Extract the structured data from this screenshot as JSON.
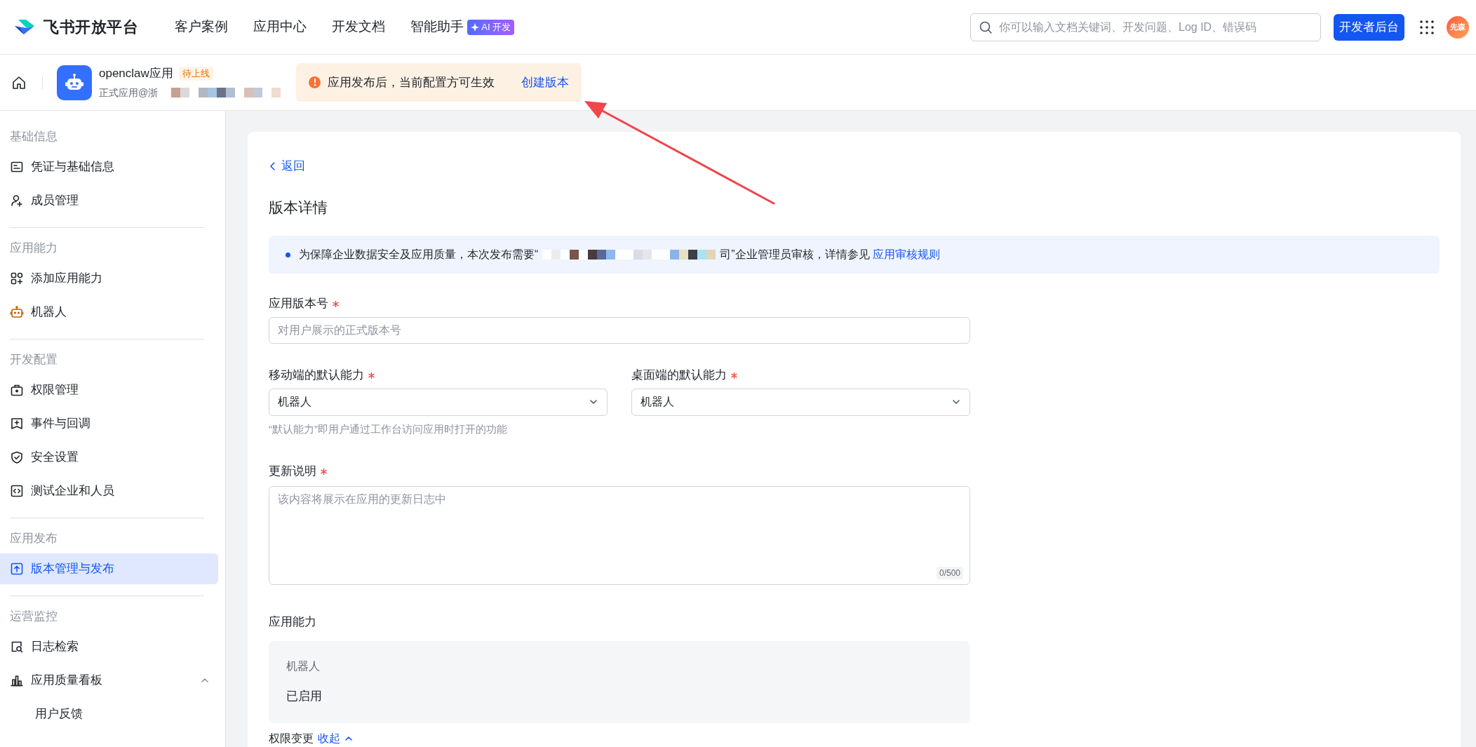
{
  "top_nav": {
    "logo_text": "飞书开放平台",
    "items": [
      {
        "label": "客户案例"
      },
      {
        "label": "应用中心"
      },
      {
        "label": "开发文档"
      },
      {
        "label": "智能助手",
        "badge": "AI 开发"
      }
    ],
    "search": {
      "placeholder": "你可以输入文档关键词、开发问题、Log ID、错误码"
    },
    "console_button": "开发者后台",
    "avatar_text": "先森"
  },
  "app_bar": {
    "name": "openclaw应用",
    "status_badge": "待上线",
    "subtitle": "正式应用@浙",
    "notice": {
      "text": "应用发布后，当前配置方可生效",
      "link": "创建版本"
    }
  },
  "sidebar": [
    {
      "heading": "基础信息",
      "items": [
        {
          "label": "凭证与基础信息",
          "selected": false
        },
        {
          "label": "成员管理",
          "selected": false
        }
      ]
    },
    {
      "heading": "应用能力",
      "items": [
        {
          "label": "添加应用能力",
          "selected": false
        },
        {
          "label": "机器人",
          "selected": false
        }
      ]
    },
    {
      "heading": "开发配置",
      "items": [
        {
          "label": "权限管理",
          "selected": false
        },
        {
          "label": "事件与回调",
          "selected": false
        },
        {
          "label": "安全设置",
          "selected": false
        },
        {
          "label": "测试企业和人员",
          "selected": false
        }
      ]
    },
    {
      "heading": "应用发布",
      "items": [
        {
          "label": "版本管理与发布",
          "selected": true
        }
      ]
    },
    {
      "heading": "运营监控",
      "items": [
        {
          "label": "日志检索",
          "selected": false
        },
        {
          "label": "应用质量看板",
          "selected": false,
          "expanded": true,
          "children": [
            {
              "label": "用户反馈",
              "selected": false
            }
          ]
        }
      ]
    }
  ],
  "detail": {
    "back": "返回",
    "title": "版本详情",
    "notice": {
      "before": "为保障企业数据安全及应用质量，本次发布需要“",
      "after": "司”企业管理员审核，详情参见",
      "link": "应用审核规则"
    },
    "version": {
      "label": "应用版本号",
      "required": true,
      "placeholder": "对用户展示的正式版本号"
    },
    "mobile": {
      "label": "移动端的默认能力",
      "required": true,
      "value": "机器人"
    },
    "desktop": {
      "label": "桌面端的默认能力",
      "required": true,
      "value": "机器人"
    },
    "hint": "“默认能力”即用户通过工作台访问应用时打开的功能",
    "notes": {
      "label": "更新说明",
      "required": true,
      "placeholder": "该内容将展示在应用的更新日志中",
      "counter": "0/500"
    },
    "abilities": {
      "label": "应用能力",
      "items": [
        {
          "name": "机器人",
          "status": "已启用"
        }
      ]
    },
    "permissions": {
      "label": "权限变更",
      "toggle": "收起"
    }
  }
}
